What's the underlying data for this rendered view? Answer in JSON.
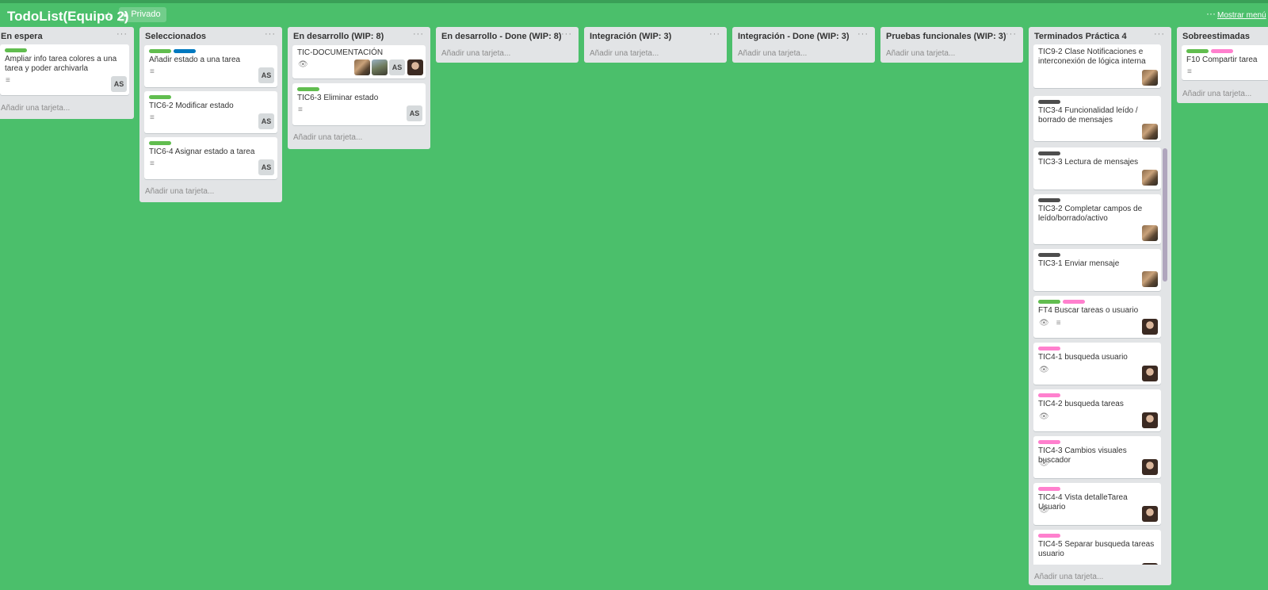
{
  "colors": {
    "background": "#4bbf6b",
    "list": "#e2e4e6",
    "label_green": "#61bd4f",
    "label_blue": "#0079bf",
    "label_black": "#4d4d4d",
    "label_pink": "#ff80ce"
  },
  "header": {
    "board_title": "TodoList(Equipo 2)",
    "star_icon": "star-icon",
    "privacy_label": "Privado",
    "menu_dots": "···",
    "show_menu": "Mostrar menú"
  },
  "add_card_text": "Añadir una tarjeta...",
  "lists": [
    {
      "title": "En espera",
      "cards": [
        {
          "labels": [
            "green"
          ],
          "title": "Ampliar info tarea colores a una tarea y poder archivarla",
          "badges": [
            "description-icon"
          ],
          "members": [
            "AS"
          ]
        }
      ]
    },
    {
      "title": "Seleccionados",
      "cards": [
        {
          "labels": [
            "green",
            "blue"
          ],
          "title": "Añadir estado a una tarea",
          "badges": [
            "description-icon"
          ],
          "members": [
            "AS"
          ]
        },
        {
          "labels": [
            "green"
          ],
          "title": "TIC6-2 Modificar estado",
          "badges": [
            "description-icon"
          ],
          "members": [
            "AS"
          ]
        },
        {
          "labels": [
            "green"
          ],
          "title": "TIC6-4 Asignar estado a tarea",
          "badges": [
            "description-icon"
          ],
          "members": [
            "AS"
          ]
        }
      ]
    },
    {
      "title": "En desarrollo (WIP: 8)",
      "cards": [
        {
          "labels": [],
          "title": "TIC-DOCUMENTACIÓN",
          "badges": [
            "eye-icon"
          ],
          "members": [
            "photo",
            "photo",
            "AS",
            "photo"
          ]
        },
        {
          "labels": [
            "green"
          ],
          "title": "TIC6-3 Eliminar estado",
          "badges": [
            "description-icon"
          ],
          "members": [
            "AS"
          ]
        }
      ]
    },
    {
      "title": "En desarrollo - Done (WIP: 8)",
      "cards": []
    },
    {
      "title": "Integración (WIP: 3)",
      "cards": []
    },
    {
      "title": "Integración - Done (WIP: 3)",
      "cards": []
    },
    {
      "title": "Pruebas funcionales (WIP: 3)",
      "cards": []
    },
    {
      "title": "Terminados Práctica 4",
      "cards": [
        {
          "labels": [],
          "title": "TIC9-2 Clase Notificaciones e interconexión de lógica interna",
          "badges": [],
          "members": [
            "photo"
          ]
        },
        {
          "labels": [
            "black"
          ],
          "title": "TIC3-4 Funcionalidad leído / borrado de mensajes",
          "badges": [],
          "members": [
            "photo"
          ]
        },
        {
          "labels": [
            "black"
          ],
          "title": "TIC3-3 Lectura de mensajes",
          "badges": [],
          "members": [
            "photo"
          ]
        },
        {
          "labels": [
            "black"
          ],
          "title": "TIC3-2 Completar campos de leído/borrado/activo",
          "badges": [],
          "members": [
            "photo"
          ]
        },
        {
          "labels": [
            "black"
          ],
          "title": "TIC3-1 Enviar mensaje",
          "badges": [],
          "members": [
            "photo"
          ]
        },
        {
          "labels": [
            "green",
            "pink"
          ],
          "title": "FT4 Buscar tareas o usuario",
          "badges": [
            "eye-icon",
            "description-icon"
          ],
          "members": [
            "photo"
          ]
        },
        {
          "labels": [
            "pink"
          ],
          "title": "TIC4-1 busqueda usuario",
          "badges": [
            "eye-icon"
          ],
          "members": [
            "photo"
          ]
        },
        {
          "labels": [
            "pink"
          ],
          "title": "TIC4-2 busqueda tareas",
          "badges": [
            "eye-icon"
          ],
          "members": [
            "photo"
          ]
        },
        {
          "labels": [
            "pink"
          ],
          "title": "TIC4-3 Cambios visuales buscador",
          "badges": [
            "eye-icon"
          ],
          "members": [
            "photo"
          ]
        },
        {
          "labels": [
            "pink"
          ],
          "title": "TIC4-4 Vista detalleTarea Usuario",
          "badges": [
            "eye-icon"
          ],
          "members": [
            "photo"
          ]
        },
        {
          "labels": [
            "pink"
          ],
          "title": "TIC4-5 Separar busqueda tareas usuario",
          "badges": [],
          "members": [
            "photo"
          ]
        }
      ]
    },
    {
      "title": "Sobreestimadas",
      "cards": [
        {
          "labels": [
            "green",
            "pink"
          ],
          "title": "F10 Compartir tarea",
          "badges": [
            "description-icon"
          ],
          "members": []
        }
      ]
    }
  ]
}
